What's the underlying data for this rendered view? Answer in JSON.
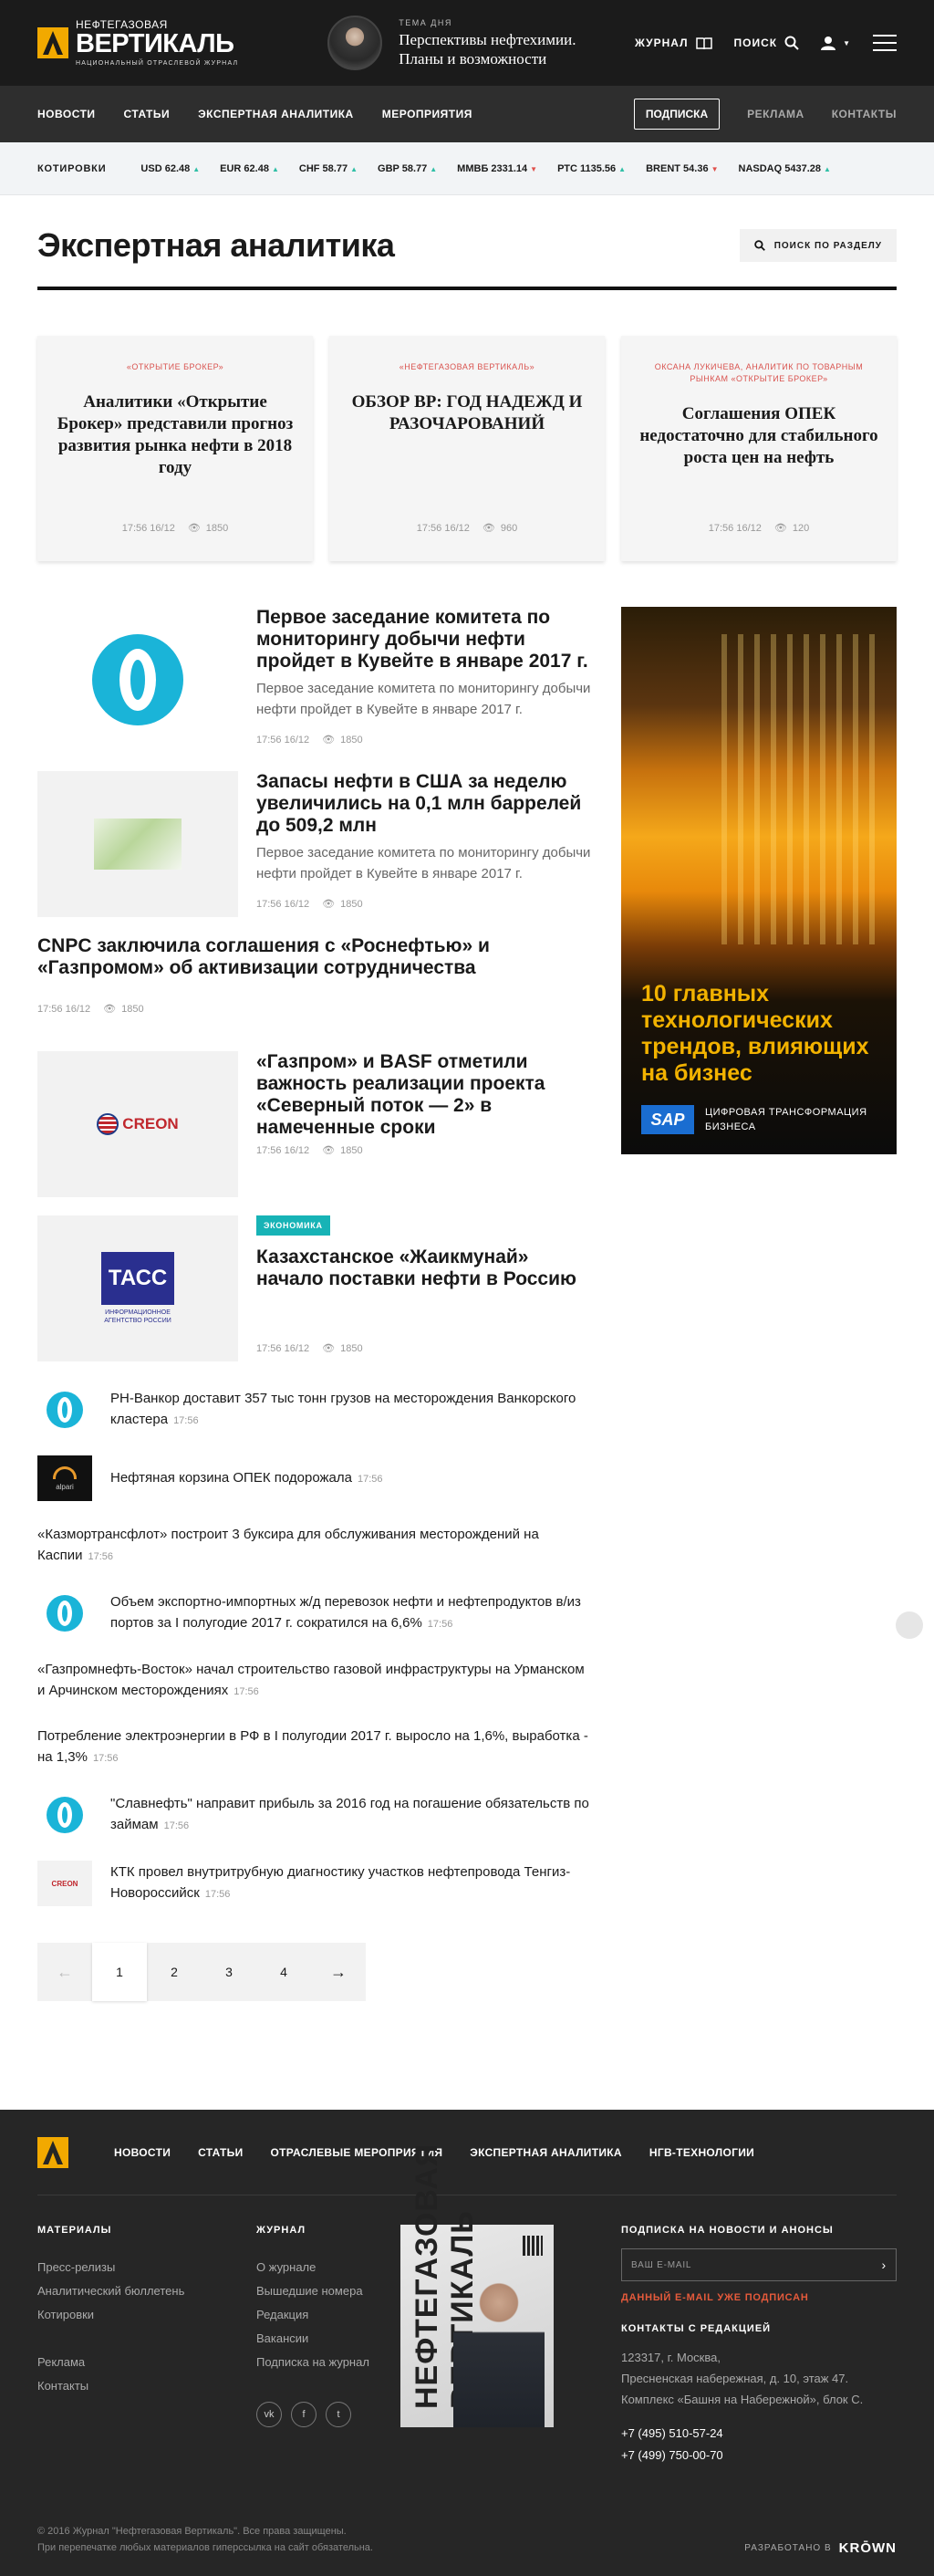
{
  "header": {
    "logo_small": "НЕФТЕГАЗОВАЯ",
    "logo_big": "ВЕРТИКАЛЬ",
    "logo_sub": "НАЦИОНАЛЬНЫЙ ОТРАСЛЕВОЙ ЖУРНАЛ",
    "topic_label": "ТЕМА ДНЯ",
    "topic_title_1": "Перспективы нефтехимии.",
    "topic_title_2": "Планы и возможности",
    "journal": "ЖУРНАЛ",
    "search": "ПОИСК"
  },
  "nav": {
    "items": [
      "НОВОСТИ",
      "СТАТЬИ",
      "ЭКСПЕРТНАЯ АНАЛИТИКА",
      "МЕРОПРИЯТИЯ"
    ],
    "subscribe": "ПОДПИСКА",
    "ads": "РЕКЛАМА",
    "contacts": "КОНТАКТЫ"
  },
  "quotes": {
    "title": "КОТИРОВКИ",
    "items": [
      {
        "label": "USD 62.48",
        "dir": "up"
      },
      {
        "label": "EUR 62.48",
        "dir": "up"
      },
      {
        "label": "CHF 58.77",
        "dir": "up"
      },
      {
        "label": "GBP 58.77",
        "dir": "up"
      },
      {
        "label": "ММВБ 2331.14",
        "dir": "down"
      },
      {
        "label": "РТС 1135.56",
        "dir": "up"
      },
      {
        "label": "BRENT 54.36",
        "dir": "down"
      },
      {
        "label": "NASDAQ 5437.28",
        "dir": "up"
      }
    ]
  },
  "page": {
    "title": "Экспертная аналитика",
    "search_section": "ПОИСК ПО РАЗДЕЛУ"
  },
  "cards": [
    {
      "tag": "«ОТКРЫТИЕ БРОКЕР»",
      "title": "Аналитики «Открытие Брокер» представили прогноз развития рынка нефти в 2018 году",
      "time": "17:56 16/12",
      "views": "1850"
    },
    {
      "tag": "«НЕФТЕГАЗОВАЯ ВЕРТИКАЛЬ»",
      "title": "ОБЗОР BP: ГОД НАДЕЖД И РАЗОЧАРОВАНИЙ",
      "time": "17:56 16/12",
      "views": "960"
    },
    {
      "tag": "ОКСАНА ЛУКИЧЕВА, АНАЛИТИК ПО ТОВАРНЫМ РЫНКАМ «ОТКРЫТИЕ БРОКЕР»",
      "title": "Соглашения ОПЕК недостаточно для стабильного роста цен на нефть",
      "time": "17:56 16/12",
      "views": "120"
    }
  ],
  "articles": {
    "a1": {
      "title": "Первое заседание комитета по мониторингу добычи нефти пройдет в Кувейте в январе 2017 г.",
      "lead": "Первое заседание комитета по мониторингу добычи нефти пройдет в Кувейте в январе 2017 г.",
      "time": "17:56 16/12",
      "views": "1850"
    },
    "a2": {
      "title": "Запасы нефти в США за неделю увеличились на 0,1 млн баррелей до 509,2 млн",
      "lead": "Первое заседание комитета по мониторингу добычи нефти пройдет в Кувейте в январе 2017 г.",
      "time": "17:56 16/12",
      "views": "1850"
    },
    "a3": {
      "title": "CNPC заключила соглашения с «Роснефтью» и «Газпромом» об активизации сотрудничества",
      "time": "17:56 16/12",
      "views": "1850"
    },
    "a4": {
      "title": "«Газпром» и BASF отметили важность реализации проекта «Северный поток — 2» в намеченные сроки",
      "logo": "CREON",
      "time": "17:56 16/12",
      "views": "1850"
    },
    "a5": {
      "badge": "ЭКОНОМИКА",
      "title": "Казахстанское «Жаикмунай» начало поставки нефти в Россию",
      "logo": "ТАСС",
      "logo_sub": "ИНФОРМАЦИОННОЕ АГЕНТСТВО РОССИИ",
      "time": "17:56 16/12",
      "views": "1850"
    }
  },
  "news_list": [
    {
      "thumb": "ring",
      "text": "РН-Ванкор доставит 357 тыс тонн грузов на месторождения Ванкорского кластера",
      "time": "17:56"
    },
    {
      "thumb": "alpari",
      "text": "Нефтяная корзина ОПЕК подорожала",
      "time": "17:56"
    },
    {
      "thumb": "none",
      "text": "«Казмортрансфлот» построит 3 буксира для обслуживания месторождений на Каспии",
      "time": "17:56"
    },
    {
      "thumb": "ring",
      "text": "Объем экспортно-импортных ж/д перевозок нефти и нефтепродуктов в/из портов за I полугодие 2017 г. сократился на 6,6%",
      "time": "17:56"
    },
    {
      "thumb": "none",
      "text": "«Газпромнефть-Восток» начал строительство газовой инфраструктуры на Урманском и Арчинском месторождениях",
      "time": "17:56"
    },
    {
      "thumb": "none",
      "text": "Потребление электроэнергии в РФ в I полугодии 2017 г. выросло на 1,6%, выработка - на 1,3%",
      "time": "17:56"
    },
    {
      "thumb": "ring",
      "text": "\"Славнефть\" направит прибыль за 2016 год на погашение обязательств по займам",
      "time": "17:56"
    },
    {
      "thumb": "creon",
      "text": "КТК провел внутритрубную диагностику участков нефтепровода Тенгиз-Новороссийск",
      "time": "17:56"
    }
  ],
  "thumb_labels": {
    "alpari": "alpari",
    "creon": "CREON"
  },
  "pager": [
    "1",
    "2",
    "3",
    "4"
  ],
  "ad": {
    "headline": "10 главных технологических трендов, влияющих на бизнес",
    "brand": "SAP",
    "caption_1": "ЦИФРОВАЯ ТРАНСФОРМАЦИЯ",
    "caption_2": "БИЗНЕСА"
  },
  "footer": {
    "nav": [
      "НОВОСТИ",
      "СТАТЬИ",
      "ОТРАСЛЕВЫЕ МЕРОПРИЯТИЯ",
      "ЭКСПЕРТНАЯ АНАЛИТИКА",
      "НГВ-ТЕХНОЛОГИИ"
    ],
    "materials_head": "МАТЕРИАЛЫ",
    "materials": [
      "Пресс-релизы",
      "Аналитический бюллетень",
      "Котировки"
    ],
    "materials2": [
      "Реклама",
      "Контакты"
    ],
    "journal_head": "ЖУРНАЛ",
    "journal": [
      "О журнале",
      "Вышедшие номера",
      "Редакция",
      "Вакансии",
      "Подписка на журнал"
    ],
    "social": [
      "vk",
      "f",
      "t"
    ],
    "magazine_title": "НЕФТЕГАЗОВАЯ ВЕРТИКАЛЬ",
    "subscribe_head": "ПОДПИСКА НА НОВОСТИ И АНОНСЫ",
    "email_placeholder": "ВАШ E-MAIL",
    "email_note": "ДАННЫЙ E-MAIL УЖЕ ПОДПИСАН",
    "contacts_head": "КОНТАКТЫ С РЕДАКЦИЕЙ",
    "address_1": "123317, г. Москва,",
    "address_2": "Пресненская набережная, д. 10, этаж 47.",
    "address_3": "Комплекс «Башня на Набережной», блок С.",
    "phone_1": "+7 (495) 510-57-24",
    "phone_2": "+7 (499) 750-00-70",
    "copy_1": "© 2016 Журнал \"Нефтегазовая Вертикаль\". Все права защищены.",
    "copy_2": "При перепечатке любых материалов гиперссылка на сайт обязательна.",
    "dev_label": "РАЗРАБОТАНО В",
    "dev_name": "KRŌWN"
  }
}
